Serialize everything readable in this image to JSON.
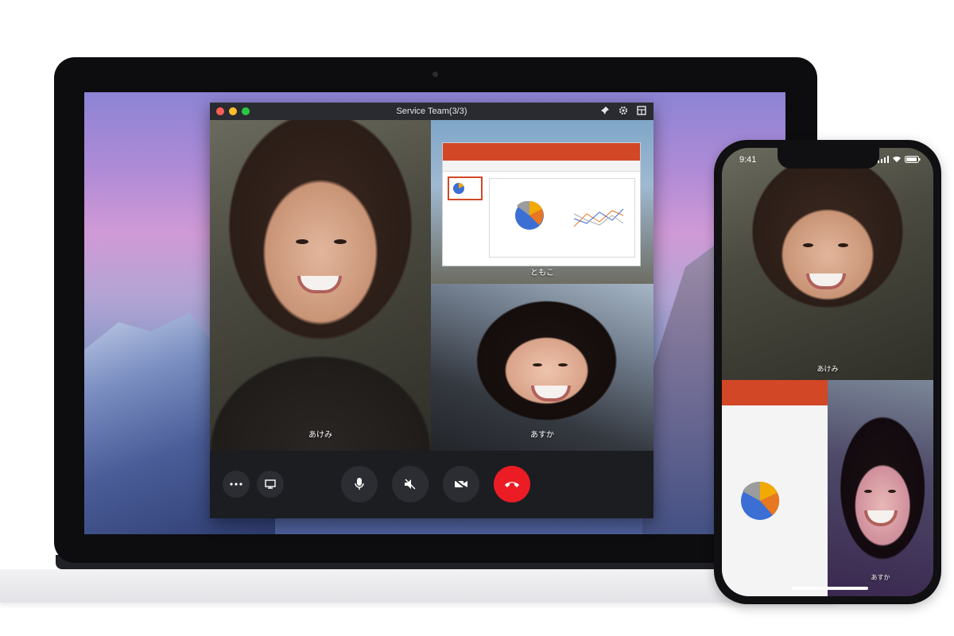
{
  "window": {
    "title": "Service Team(3/3)"
  },
  "participants": {
    "main": "あけみ",
    "screen_share": "ともこ",
    "third": "あすか"
  },
  "controls": {
    "more": "more-options",
    "screen": "screen-share",
    "mic": "microphone",
    "speaker": "speaker-mute",
    "camera": "camera-off",
    "hangup": "end-call"
  },
  "phone": {
    "time": "9:41",
    "main_label": "あけみ",
    "person_label": "あすか"
  },
  "colors": {
    "hangup": "#ec1c24",
    "ppt_accent": "#d24726",
    "traffic_red": "#ff5f57",
    "traffic_yellow": "#febc2e",
    "traffic_green": "#28c840"
  }
}
